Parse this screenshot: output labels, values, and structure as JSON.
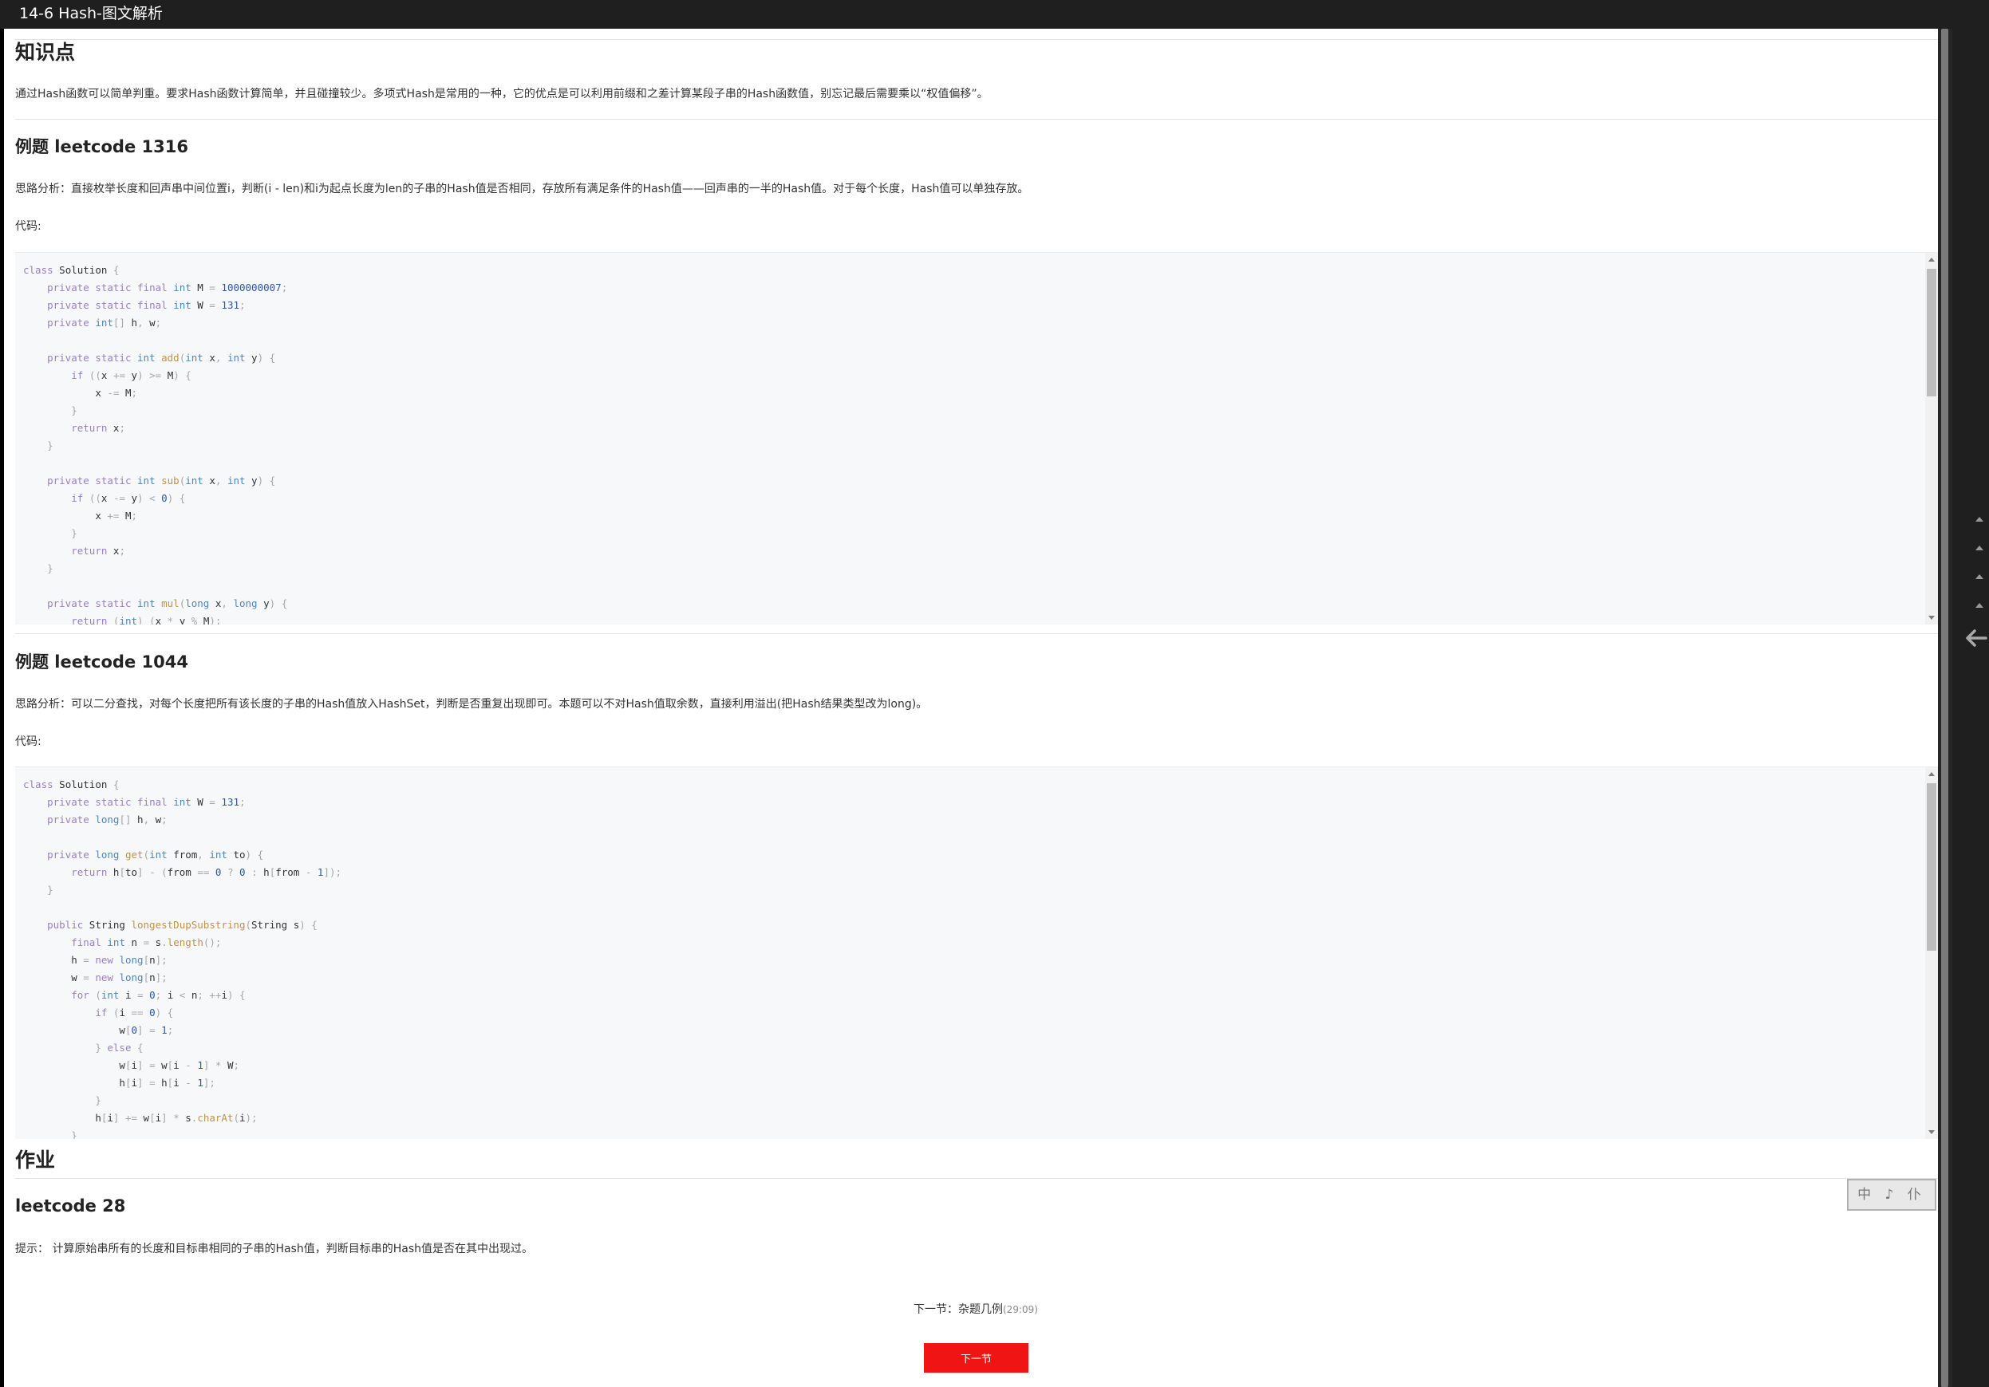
{
  "window": {
    "title": "14-6 Hash-图文解析"
  },
  "sections": {
    "knowledge": {
      "title": "知识点",
      "text": "通过Hash函数可以简单判重。要求Hash函数计算简单，并且碰撞较少。多项式Hash是常用的一种，它的优点是可以利用前缀和之差计算某段子串的Hash函数值，别忘记最后需要乘以“权值偏移”。"
    },
    "example1": {
      "title": "例题 leetcode 1316",
      "analysis": "思路分析：直接枚举长度和回声串中间位置i，判断(i - len)和i为起点长度为len的子串的Hash值是否相同，存放所有满足条件的Hash值——回声串的一半的Hash值。对于每个长度，Hash值可以单独存放。",
      "code_label": "代码:"
    },
    "example2": {
      "title": "例题 leetcode 1044",
      "analysis": "思路分析：可以二分查找，对每个长度把所有该长度的子串的Hash值放入HashSet，判断是否重复出现即可。本题可以不对Hash值取余数，直接利用溢出(把Hash结果类型改为long)。",
      "code_label": "代码:"
    },
    "homework": {
      "title": "作业",
      "subtitle": "leetcode 28",
      "hint": "提示： 计算原始串所有的长度和目标串相同的子串的Hash值，判断目标串的Hash值是否在其中出现过。"
    }
  },
  "footer": {
    "next_label": "下一节：杂题几例",
    "next_time": "(29:09)",
    "next_button": "下一节"
  },
  "language_widget": {
    "text": "中 ♪ 仆"
  },
  "icons": {
    "back": "arrow-left-icon",
    "scroll_up": "triangle-up-icon",
    "scroll_down": "triangle-down-icon"
  },
  "colors": {
    "accent": "#f01414",
    "topbar": "#1f1f1f",
    "code_bg": "#f6f8fa"
  }
}
